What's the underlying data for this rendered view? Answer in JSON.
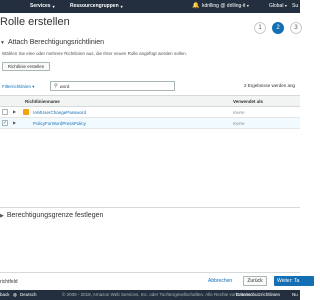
{
  "topbar": {
    "services_label": "Services",
    "resource_groups_label": "Ressourcengruppen",
    "user_label": "kdrilling @ drilling-it",
    "region_label": "Global",
    "support_label": "Su"
  },
  "page": {
    "title": "Rolle erstellen"
  },
  "wizard": {
    "steps": [
      "1",
      "2",
      "3"
    ],
    "active_step": "2"
  },
  "attach": {
    "heading": "Attach Berechtigungsrichtlinien",
    "description": "Wählen Sie eine oder mehrere Richtlinien aus, die Ihrer neuen Rolle angefügt werden sollen.",
    "create_button": "Richtlinie erstellen"
  },
  "filter": {
    "label": "Filterrichtlinien",
    "search_value": "word",
    "results": "2 Ergebnisse werden ang"
  },
  "table": {
    "columns": {
      "name": "Richtlinienname",
      "used_as": "Verwendet als"
    },
    "rows": [
      {
        "name": "IAMUserChangePassword",
        "used_as": "Keine",
        "selected": false,
        "icon": "aws-managed-policy-icon"
      },
      {
        "name": "PolicyForWordPressPolicy",
        "used_as": "Keine",
        "selected": true,
        "icon": "none"
      }
    ]
  },
  "boundary": {
    "heading": "Berechtigungsgrenze festlegen"
  },
  "footer_bar": {
    "required_note": "richtfeld",
    "cancel_label": "Abbrechen",
    "back_label": "Zurück",
    "next_label": "Weiter: Ta"
  },
  "console_footer": {
    "feedback_label": "back",
    "language_label": "Deutsch",
    "copyright": "© 2008 - 2018, Amazon Web Services, Inc. oder Tochtergesellschaften. Alle Rechte vorbehalten.",
    "privacy_label": "Datenschutzrichtlinien",
    "terms_label": "Nu"
  },
  "colors": {
    "topbar": "#232f3e",
    "link": "#146eb4",
    "accent": "#146eb4",
    "policy_icon": "#f2a30f"
  }
}
